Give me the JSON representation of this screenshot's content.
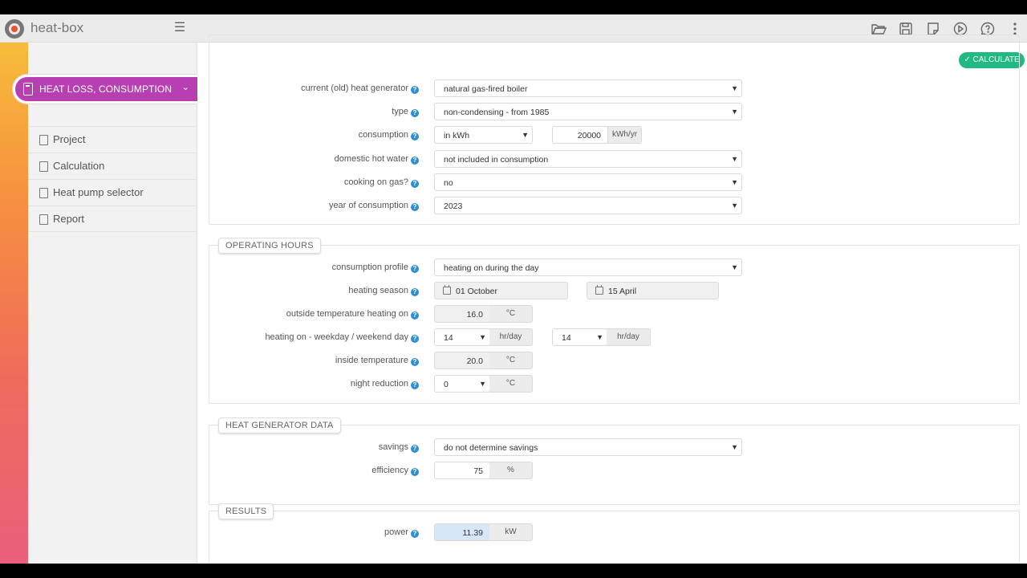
{
  "app": {
    "name": "heat-box",
    "menu_icon": "hamburger-icon"
  },
  "toolbar": {
    "icons": [
      "folder-open-icon",
      "save-icon",
      "notes-icon",
      "play-icon",
      "help-chat-icon",
      "more-vertical-icon"
    ]
  },
  "sidebar": {
    "active": {
      "label": "HEAT LOSS, CONSUMPTION",
      "color": "#b83fb2"
    },
    "items": [
      {
        "label": "Project",
        "icon": "contact-icon"
      },
      {
        "label": "Calculation",
        "icon": "calculator-icon"
      },
      {
        "label": "Heat pump selector",
        "icon": "selector-icon"
      },
      {
        "label": "Report",
        "icon": "document-icon"
      }
    ]
  },
  "calculate_button": {
    "label": "CALCULATE",
    "color": "#1fb981"
  },
  "consumption": {
    "generator": {
      "label": "current (old) heat generator",
      "value": "natural gas-fired boiler"
    },
    "type": {
      "label": "type",
      "value": "non-condensing - from 1985"
    },
    "consumption": {
      "label": "consumption",
      "mode": "in kWh",
      "value": "20000",
      "unit": "kWh/yr"
    },
    "dhw": {
      "label": "domestic hot water",
      "value": "not included in consumption"
    },
    "cooking": {
      "label": "cooking on gas?",
      "value": "no"
    },
    "year": {
      "label": "year of consumption",
      "value": "2023"
    }
  },
  "operating_hours": {
    "title": "OPERATING HOURS",
    "profile": {
      "label": "consumption profile",
      "value": "heating on during the day"
    },
    "season": {
      "label": "heating season",
      "from": "01 October",
      "to": "15 April"
    },
    "outside_temp": {
      "label": "outside temperature heating on",
      "value": "16.0",
      "unit": "°C"
    },
    "heating_on": {
      "label": "heating on - weekday / weekend day",
      "weekday": "14",
      "weekend": "14",
      "unit": "hr/day"
    },
    "inside_temp": {
      "label": "inside temperature",
      "value": "20.0",
      "unit": "°C"
    },
    "night": {
      "label": "night reduction",
      "value": "0",
      "unit": "°C"
    }
  },
  "generator_data": {
    "title": "HEAT GENERATOR DATA",
    "savings": {
      "label": "savings",
      "value": "do not determine savings"
    },
    "efficiency": {
      "label": "efficiency",
      "value": "75",
      "unit": "%"
    }
  },
  "results": {
    "title": "RESULTS",
    "power": {
      "label": "power",
      "value": "11.39",
      "unit": "kW"
    }
  }
}
